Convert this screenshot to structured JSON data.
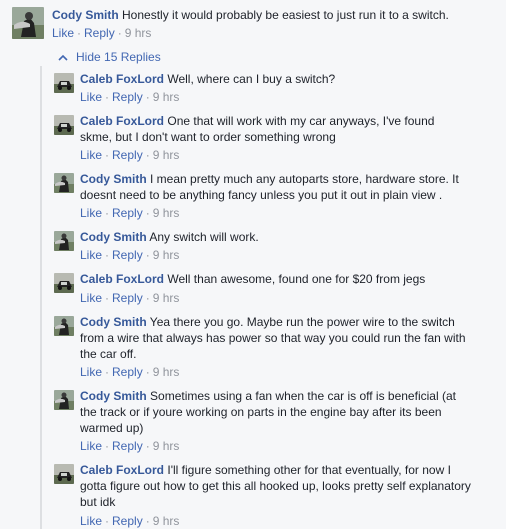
{
  "root_comment": {
    "author": "Cody Smith",
    "text": "Honestly it would probably be easiest to just run it to a switch.",
    "like": "Like",
    "reply": "Reply",
    "time": "9 hrs"
  },
  "hide_replies": {
    "label": "Hide 15 Replies"
  },
  "replies": [
    {
      "author": "Caleb FoxLord",
      "text": "Well, where can I buy a switch?",
      "like": "Like",
      "reply": "Reply",
      "time": "9 hrs"
    },
    {
      "author": "Caleb FoxLord",
      "text": "One that will work with my car anyways, I've found skme, but I don't want to order something wrong",
      "like": "Like",
      "reply": "Reply",
      "time": "9 hrs"
    },
    {
      "author": "Cody Smith",
      "text": "I mean pretty much any autoparts store, hardware store. It doesnt need to be anything fancy unless you put it out in plain view .",
      "like": "Like",
      "reply": "Reply",
      "time": "9 hrs"
    },
    {
      "author": "Cody Smith",
      "text": "Any switch will work.",
      "like": "Like",
      "reply": "Reply",
      "time": "9 hrs"
    },
    {
      "author": "Caleb FoxLord",
      "text": "Well than awesome, found one for $20 from jegs",
      "like": "Like",
      "reply": "Reply",
      "time": "9 hrs"
    },
    {
      "author": "Cody Smith",
      "text": "Yea there you go. Maybe run the power wire to the switch from a wire that always has power so that way you could run the fan with the car off.",
      "like": "Like",
      "reply": "Reply",
      "time": "9 hrs"
    },
    {
      "author": "Cody Smith",
      "text": "Sometimes using a fan when the car is off is beneficial (at the track or if youre working on parts in the engine bay after its been warmed up)",
      "like": "Like",
      "reply": "Reply",
      "time": "9 hrs"
    },
    {
      "author": "Caleb FoxLord",
      "text": "I'll figure something other for that eventually, for now I gotta figure out how to get this all hooked up, looks pretty self explanatory but idk",
      "like": "Like",
      "reply": "Reply",
      "time": "9 hrs"
    }
  ]
}
